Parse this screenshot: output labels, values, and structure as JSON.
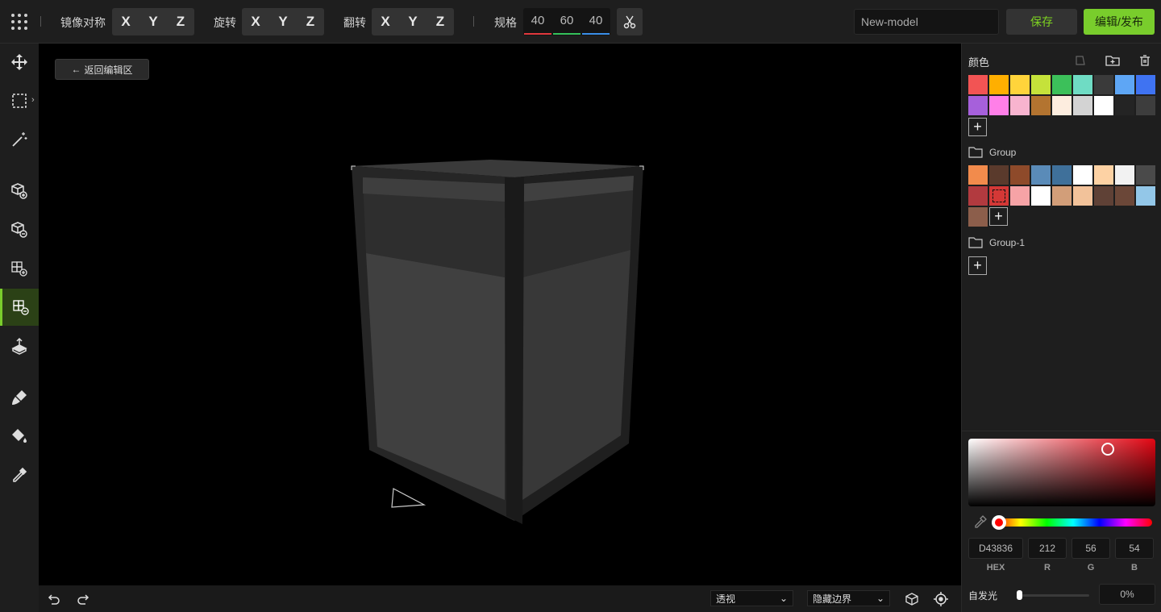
{
  "toolbar": {
    "mirror_label": "镜像对称",
    "rotate_label": "旋转",
    "flip_label": "翻转",
    "size_label": "规格",
    "axes": [
      "X",
      "Y",
      "Z"
    ],
    "size": {
      "x": "40",
      "y": "60",
      "z": "40"
    },
    "model_name": "New-model",
    "save_label": "保存",
    "publish_label": "编辑/发布"
  },
  "viewport": {
    "back_label": "返回编辑区"
  },
  "bottombar": {
    "view_mode": "透视",
    "border_mode": "隐藏边界"
  },
  "panel": {
    "color_title": "颜色",
    "palette": [
      "#F25454",
      "#FFAF00",
      "#FFD43B",
      "#C5E23A",
      "#3CC05A",
      "#6FDCC4",
      "#3A3A3A",
      "#5EA6F5",
      "#3F73F2",
      "#A660DB",
      "#FF7FE8",
      "#F8B4CF",
      "#B37430",
      "#FDEDDF",
      "#D3D3D3",
      "#FFFFFF",
      "#242424",
      "#3D3D3D"
    ],
    "groups": [
      {
        "name": "Group",
        "colors": [
          "#F28B4C",
          "#5A3A2C",
          "#8E4A2A",
          "#5A8BB8",
          "#3F709A",
          "#FFFFFF",
          "#FDD2A4",
          "#F2F2F2",
          "#4A4A4A",
          "#B23A3F",
          "#D43836",
          "#F6A3A6",
          "#FFFFFF",
          "#D29E79",
          "#F2C29A",
          "#5F4136",
          "#6B4738",
          "#93C7E8",
          "#8C5E4B"
        ],
        "selected_index": 10
      },
      {
        "name": "Group-1",
        "colors": []
      }
    ],
    "picker": {
      "hex": "D43836",
      "r": "212",
      "g": "56",
      "b": "54",
      "hex_label": "HEX",
      "r_label": "R",
      "g_label": "G",
      "b_label": "B"
    },
    "glow_label": "自发光",
    "glow_value": "0%"
  },
  "icons": {
    "apps": "apps-grid-icon",
    "cut": "scissors-icon",
    "move": "move-icon",
    "select": "select-box-icon",
    "magic": "magic-wand-icon",
    "add_cube": "cube-add-icon",
    "remove_cube": "cube-remove-icon",
    "add_multi": "cubes-add-icon",
    "remove_multi": "cubes-remove-icon",
    "extrude": "extrude-icon",
    "brush": "paint-brush-icon",
    "bucket": "paint-bucket-icon",
    "eyedropper": "eyedropper-icon",
    "undo": "undo-icon",
    "redo": "redo-icon"
  }
}
